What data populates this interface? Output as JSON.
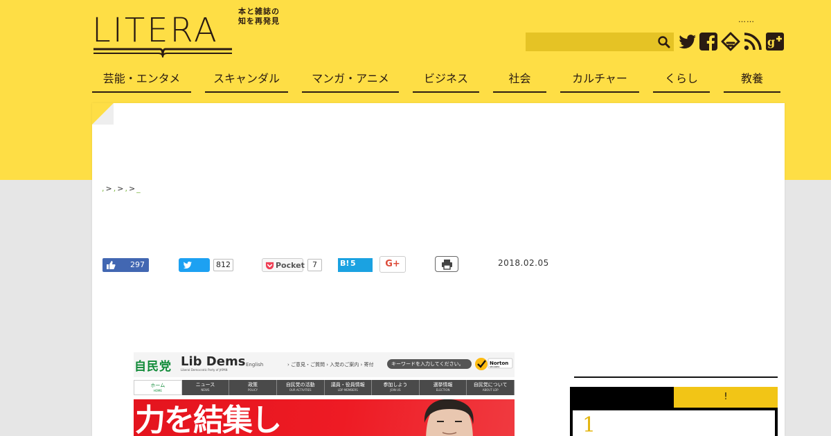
{
  "brand": {
    "logo_text": "LITERA",
    "tagline_line1": "本と雑誌の",
    "tagline_line2": "知を再発見",
    "header_dots": "……"
  },
  "search": {
    "value": "",
    "placeholder": ""
  },
  "social": [
    "twitter-icon",
    "facebook-icon",
    "feedly-icon",
    "rss-icon",
    "google-plus-icon"
  ],
  "nav": [
    {
      "label": "芸能・エンタメ"
    },
    {
      "label": "スキャンダル"
    },
    {
      "label": "マンガ・アニメ"
    },
    {
      "label": "ビジネス"
    },
    {
      "label": "社会"
    },
    {
      "label": "カルチャー"
    },
    {
      "label": "くらし"
    },
    {
      "label": "教養"
    }
  ],
  "breadcrumb": {
    "sep": ">"
  },
  "share": {
    "facebook_count": "297",
    "twitter_count": "812",
    "pocket_label": "Pocket",
    "pocket_count": "7",
    "hatena_label": "B!",
    "hatena_count": "5",
    "gplus_label": "G+"
  },
  "post_date": "2018.02.05",
  "article_image": {
    "site_name_jp": "自民党",
    "site_name_en": "Lib Dems",
    "site_subtitle": "Liberal Democratic Party of JAPAN",
    "english_link": "English",
    "header_links": "› ご意見・ご質問 › 入党のご案内 › 寄付",
    "search_placeholder": "キーワードを入力してください。",
    "badge": "Norton SECURED",
    "nav": [
      {
        "label": "ホーム",
        "sub": "HOME"
      },
      {
        "label": "ニュース",
        "sub": "NEWS"
      },
      {
        "label": "政策",
        "sub": "POLICY"
      },
      {
        "label": "自民党の活動",
        "sub": "OUR ACTIVITIES"
      },
      {
        "label": "議員・役員情報",
        "sub": "LDP MEMBERS"
      },
      {
        "label": "参加しよう",
        "sub": "JOIN US"
      },
      {
        "label": "選挙情報",
        "sub": "ELECTION"
      },
      {
        "label": "自民党について",
        "sub": "ABOUT LDP"
      }
    ],
    "banner_text": "力を結集し"
  },
  "sidebar": {
    "tab_right": "!",
    "rank_number": "1"
  },
  "colors": {
    "brand_yellow": "#fede45",
    "search_bg": "#e5c325",
    "ink": "#2a1b12",
    "rank_gold": "#e3b50f"
  }
}
